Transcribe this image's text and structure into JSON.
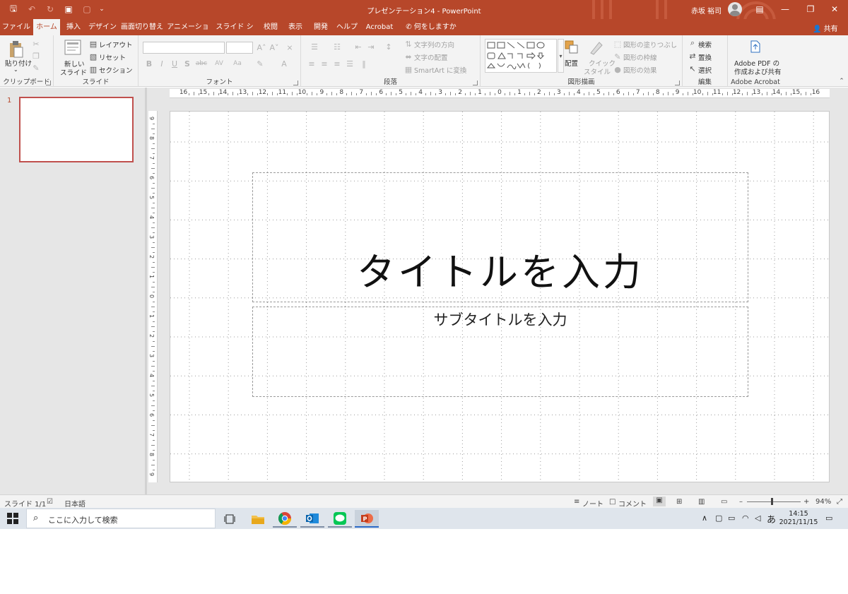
{
  "window": {
    "doc_title": "プレゼンテーション4  -  PowerPoint",
    "user_name": "赤坂 裕司",
    "share_label": "共有"
  },
  "tabs": [
    {
      "label": "ファイル"
    },
    {
      "label": "ホーム",
      "active": true
    },
    {
      "label": "挿入"
    },
    {
      "label": "デザイン"
    },
    {
      "label": "画面切り替え"
    },
    {
      "label": "アニメーション"
    },
    {
      "label": "スライド ショー"
    },
    {
      "label": "校閲"
    },
    {
      "label": "表示"
    },
    {
      "label": "開発"
    },
    {
      "label": "ヘルプ"
    },
    {
      "label": "Acrobat"
    }
  ],
  "tell_me": "何をしますか",
  "ribbon": {
    "clipboard": {
      "label": "クリップボード",
      "paste": "貼り付け"
    },
    "slides": {
      "label": "スライド",
      "new_slide_1": "新しい",
      "new_slide_2": "スライド",
      "layout": "レイアウト",
      "reset": "リセット",
      "section": "セクション"
    },
    "font": {
      "label": "フォント"
    },
    "paragraph": {
      "label": "段落",
      "text_direction": "文字列の方向",
      "align_text": "文字の配置",
      "smartart": "SmartArt に変換"
    },
    "drawing": {
      "label": "図形描画",
      "arrange": "配置",
      "quick_styles_1": "クイック",
      "quick_styles_2": "スタイル",
      "shape_fill": "図形の塗りつぶし",
      "shape_outline": "図形の枠線",
      "shape_effects": "図形の効果"
    },
    "editing": {
      "label": "編集",
      "find": "検索",
      "replace": "置換",
      "select": "選択"
    },
    "acrobat": {
      "label": "Adobe Acrobat",
      "btn_1": "Adobe PDF の",
      "btn_2": "作成および共有"
    }
  },
  "thumbnails": {
    "slide_number": "1"
  },
  "ruler": {
    "h_labels": [
      "16",
      "15",
      "14",
      "13",
      "12",
      "11",
      "10",
      "9",
      "8",
      "7",
      "6",
      "5",
      "4",
      "3",
      "2",
      "1",
      "0",
      "1",
      "2",
      "3",
      "4",
      "5",
      "6",
      "7",
      "8",
      "9",
      "10",
      "11",
      "12",
      "13",
      "14",
      "15",
      "16"
    ],
    "v_labels": [
      "9",
      "8",
      "7",
      "6",
      "5",
      "4",
      "3",
      "2",
      "1",
      "0",
      "1",
      "2",
      "3",
      "4",
      "5",
      "6",
      "7",
      "8",
      "9"
    ]
  },
  "slide": {
    "title_placeholder": "タイトルを入力",
    "subtitle_placeholder": "サブタイトルを入力"
  },
  "statusbar": {
    "slide_info": "スライド 1/1",
    "language": "日本語",
    "notes": "ノート",
    "comments": "コメント",
    "zoom": "94%",
    "zoom_minus": "–",
    "zoom_plus": "+"
  },
  "taskbar": {
    "search_placeholder": "ここに入力して検索",
    "time": "14:15",
    "date": "2021/11/15",
    "ime": "あ"
  }
}
